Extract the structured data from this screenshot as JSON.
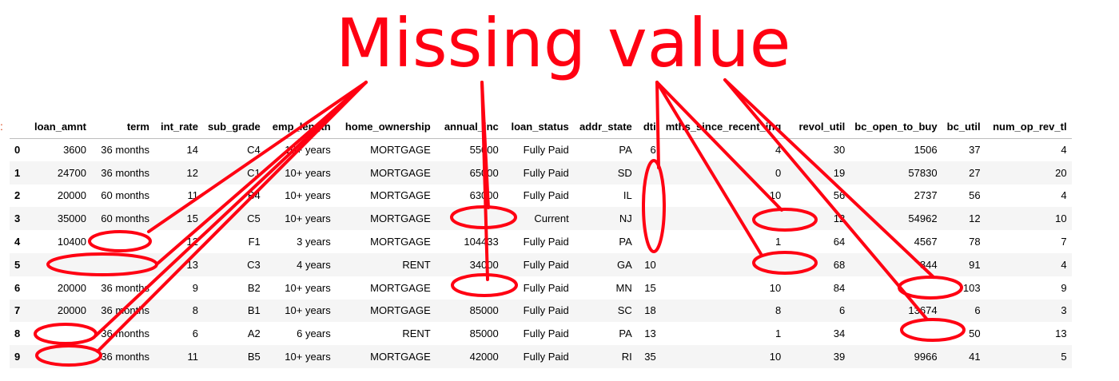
{
  "title": "Missing value",
  "prompt_mark": ":",
  "colors": {
    "annotation": "#ff0012",
    "row_stripe": "#f5f5f5"
  },
  "table": {
    "columns": [
      "",
      "loan_amnt",
      "term",
      "int_rate",
      "sub_grade",
      "emp_length",
      "home_ownership",
      "annual_inc",
      "loan_status",
      "addr_state",
      "dti",
      "mths_since_recent_inq",
      "revol_util",
      "bc_open_to_buy",
      "bc_util",
      "num_op_rev_tl"
    ],
    "rows": [
      [
        "0",
        "3600",
        "36 months",
        "14",
        "C4",
        "10+ years",
        "MORTGAGE",
        "55000",
        "Fully Paid",
        "PA",
        "6",
        "4",
        "30",
        "1506",
        "37",
        "4"
      ],
      [
        "1",
        "24700",
        "36 months",
        "12",
        "C1",
        "10+ years",
        "MORTGAGE",
        "65000",
        "Fully Paid",
        "SD",
        "",
        "0",
        "19",
        "57830",
        "27",
        "20"
      ],
      [
        "2",
        "20000",
        "60 months",
        "11",
        "B4",
        "10+ years",
        "MORTGAGE",
        "63000",
        "Fully Paid",
        "IL",
        "",
        "10",
        "56",
        "2737",
        "56",
        "4"
      ],
      [
        "3",
        "35000",
        "60 months",
        "15",
        "C5",
        "10+ years",
        "MORTGAGE",
        "",
        "Current",
        "NJ",
        "",
        "",
        "12",
        "54962",
        "12",
        "10"
      ],
      [
        "4",
        "10400",
        "",
        "12",
        "F1",
        "3 years",
        "MORTGAGE",
        "104433",
        "Fully Paid",
        "PA",
        "",
        "1",
        "64",
        "4567",
        "78",
        "7"
      ],
      [
        "5",
        "",
        "",
        "13",
        "C3",
        "4 years",
        "RENT",
        "34000",
        "Fully Paid",
        "GA",
        "10",
        "",
        "68",
        "844",
        "91",
        "4"
      ],
      [
        "6",
        "20000",
        "36 months",
        "9",
        "B2",
        "10+ years",
        "MORTGAGE",
        "",
        "Fully Paid",
        "MN",
        "15",
        "10",
        "84",
        "",
        "103",
        "9"
      ],
      [
        "7",
        "20000",
        "36 months",
        "8",
        "B1",
        "10+ years",
        "MORTGAGE",
        "85000",
        "Fully Paid",
        "SC",
        "18",
        "8",
        "6",
        "13674",
        "6",
        "3"
      ],
      [
        "8",
        "",
        "36 months",
        "6",
        "A2",
        "6 years",
        "RENT",
        "85000",
        "Fully Paid",
        "PA",
        "13",
        "1",
        "34",
        "",
        "50",
        "13"
      ],
      [
        "9",
        "",
        "36 months",
        "11",
        "B5",
        "10+ years",
        "MORTGAGE",
        "42000",
        "Fully Paid",
        "RI",
        "35",
        "10",
        "39",
        "9966",
        "41",
        "5"
      ]
    ]
  }
}
